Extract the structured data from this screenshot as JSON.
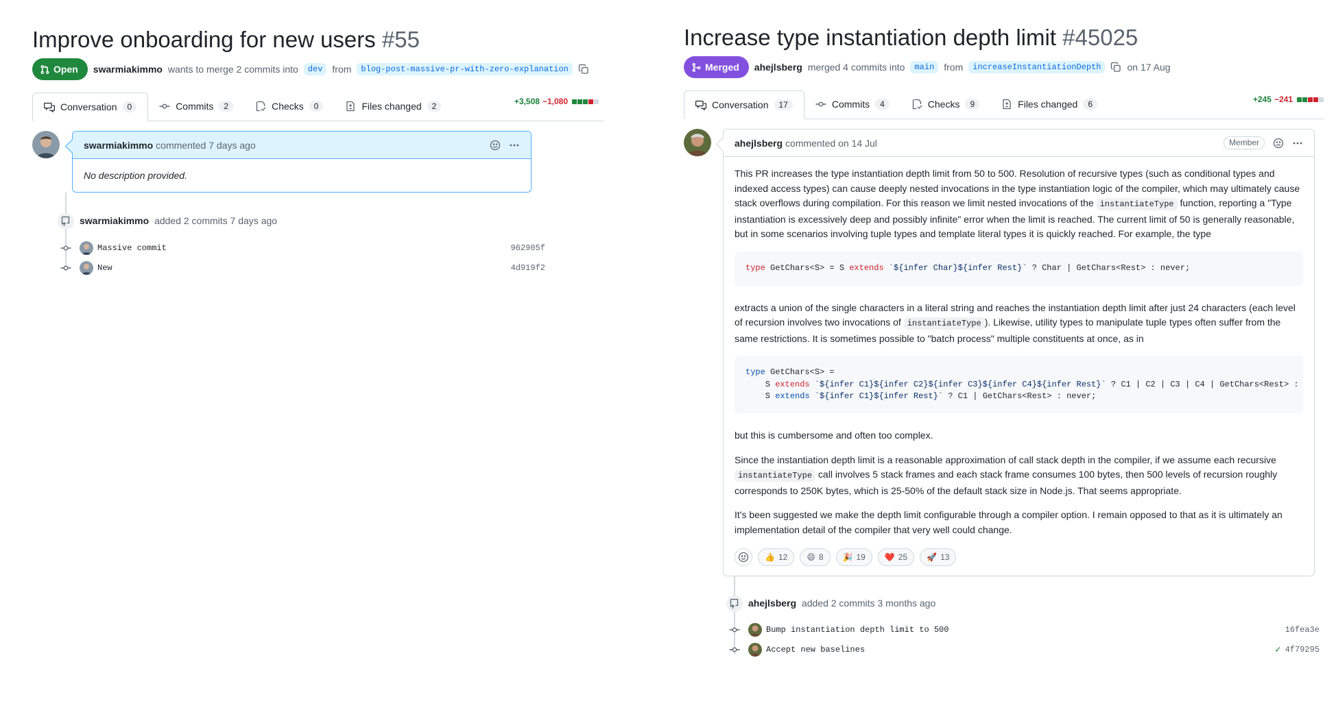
{
  "left": {
    "title": "Improve onboarding for new users",
    "number": "#55",
    "state": "Open",
    "author": "swarmiakimmo",
    "meta_text": "wants to merge 2 commits into",
    "base_branch": "dev",
    "from_text": "from",
    "head_branch": "blog-post-massive-pr-with-zero-explanation",
    "tabs": [
      {
        "label": "Conversation",
        "count": "0"
      },
      {
        "label": "Commits",
        "count": "2"
      },
      {
        "label": "Checks",
        "count": "0"
      },
      {
        "label": "Files changed",
        "count": "2"
      }
    ],
    "additions": "+3,508",
    "deletions": "−1,080",
    "diff_blocks": [
      "#1f883d",
      "#1f883d",
      "#1f883d",
      "#cf222e",
      "#d1d9e0"
    ],
    "comment": {
      "author": "swarmiakimmo",
      "action": "commented 7 days ago",
      "body": "No description provided."
    },
    "event": {
      "author": "swarmiakimmo",
      "action": "added 2 commits 7 days ago"
    },
    "commits": [
      {
        "message": "Massive commit",
        "sha": "962905f"
      },
      {
        "message": "New",
        "sha": "4d919f2"
      }
    ]
  },
  "right": {
    "title": "Increase type instantiation depth limit",
    "number": "#45025",
    "state": "Merged",
    "author": "ahejlsberg",
    "meta_text": "merged 4 commits into",
    "base_branch": "main",
    "from_text": "from",
    "head_branch": "increaseInstantiationDepth",
    "date_text": "on 17 Aug",
    "tabs": [
      {
        "label": "Conversation",
        "count": "17"
      },
      {
        "label": "Commits",
        "count": "4"
      },
      {
        "label": "Checks",
        "count": "9"
      },
      {
        "label": "Files changed",
        "count": "6"
      }
    ],
    "additions": "+245",
    "deletions": "−241",
    "diff_blocks": [
      "#1f883d",
      "#1f883d",
      "#cf222e",
      "#cf222e",
      "#d1d9e0"
    ],
    "comment": {
      "author": "ahejlsberg",
      "action": "commented on 14 Jul",
      "badge": "Member",
      "p1_a": "This PR increases the type instantiation depth limit from 50 to 500. Resolution of recursive types (such as conditional types and indexed access types) can cause deeply nested invocations in the type instantiation logic of the compiler, which may ultimately cause stack overflows during compilation. For this reason we limit nested invocations of the",
      "p1_code": "instantiateType",
      "p1_b": "function, reporting a \"Type instantiation is excessively deep and possibly infinite\" error when the limit is reached. The current limit of 50 is generally reasonable, but in some scenarios involving tuple types and template literal types it is quickly reached. For example, the type",
      "code1": {
        "kw_type": "type",
        "a": " GetChars",
        "b": "<S> = S ",
        "kw_extends": "extends",
        "str": " `${infer Char}${infer Rest}`",
        "c": " ? Char | GetChars<Rest> : never;"
      },
      "p2_a": "extracts a union of the single characters in a literal string and reaches the instantiation depth limit after just 24 characters (each level of recursion involves two invocations of",
      "p2_code": "instantiateType",
      "p2_b": "). Likewise, utility types to manipulate tuple types often suffer from the same restrictions. It is sometimes possible to \"batch process\" multiple constituents at once, as in",
      "code2": {
        "l1_kw": "type",
        "l1_rest": " GetChars<S> =",
        "l2_pre": "    S ",
        "l2_kw": "extends",
        "l2_str": " `${infer C1}${infer C2}${infer C3}${infer C4}${infer Rest}`",
        "l2_rest": " ? C1 | C2 | C3 | C4 | GetChars<Rest> :",
        "l3_pre": "    S ",
        "l3_kw": "extends",
        "l3_str": " `${infer C1}${infer Rest}`",
        "l3_rest": " ? C1 | GetChars<Rest> : never;"
      },
      "p3": "but this is cumbersome and often too complex.",
      "p4_a": "Since the instantiation depth limit is a reasonable approximation of call stack depth in the compiler, if we assume each recursive",
      "p4_code": "instantiateType",
      "p4_b": "call involves 5 stack frames and each stack frame consumes 100 bytes, then 500 levels of recursion roughly corresponds to 250K bytes, which is 25-50% of the default stack size in Node.js. That seems appropriate.",
      "p5": "It's been suggested we make the depth limit configurable through a compiler option. I remain opposed to that as it is ultimately an implementation detail of the compiler that very well could change.",
      "reactions": [
        {
          "emoji": "👍",
          "count": "12"
        },
        {
          "emoji": "😄",
          "count": "8"
        },
        {
          "emoji": "🎉",
          "count": "19"
        },
        {
          "emoji": "❤️",
          "count": "25"
        },
        {
          "emoji": "🚀",
          "count": "13"
        }
      ]
    },
    "event": {
      "author": "ahejlsberg",
      "action": "added 2 commits 3 months ago"
    },
    "commits": [
      {
        "message": "Bump instantiation depth limit to 500",
        "sha": "16fea3e",
        "check": ""
      },
      {
        "message": "Accept new baselines",
        "sha": "4f79295",
        "check": "✓"
      }
    ]
  }
}
